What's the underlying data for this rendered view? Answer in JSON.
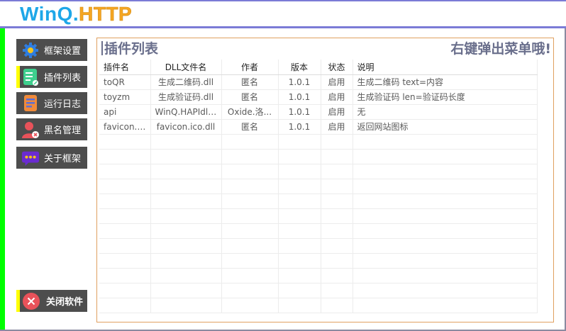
{
  "app": {
    "logo_part1": "WinQ.",
    "logo_part2": "HTTP"
  },
  "nav": {
    "items": [
      {
        "label": "框架设置",
        "icon": "gear-icon"
      },
      {
        "label": "插件列表",
        "icon": "document-edit-icon",
        "active": true
      },
      {
        "label": "运行日志",
        "icon": "log-icon"
      },
      {
        "label": "黑名管理",
        "icon": "user-block-icon"
      },
      {
        "label": "关于框架",
        "icon": "chat-bubble-icon"
      }
    ],
    "close_label": "关闭软件",
    "close_icon": "close-icon"
  },
  "panel": {
    "title": "插件列表",
    "hint": "右键弹出菜单哦!"
  },
  "table": {
    "headers": [
      "插件名",
      "DLL文件名",
      "作者",
      "版本",
      "状态",
      "说明"
    ],
    "rows": [
      [
        "toQR",
        "生成二维码.dll",
        "匿名",
        "1.0.1",
        "启用",
        "生成二维码 text=内容"
      ],
      [
        "toyzm",
        "生成验证码.dll",
        "匿名",
        "1.0.1",
        "启用",
        "生成验证码 len=验证码长度"
      ],
      [
        "api",
        "WinQ.HAPIdll...",
        "Oxide.洛...",
        "1.0.1",
        "启用",
        "无"
      ],
      [
        "favicon.ico",
        "favicon.ico.dll",
        "匿名",
        "1.0.1",
        "启用",
        "返回网站图标"
      ]
    ]
  },
  "colors": {
    "accent": "#7b7bd6",
    "left_strip": "#00ff00",
    "active_marker": "#ffff00",
    "nav_bg": "#4d4d4d",
    "panel_border": "#e0a060"
  }
}
